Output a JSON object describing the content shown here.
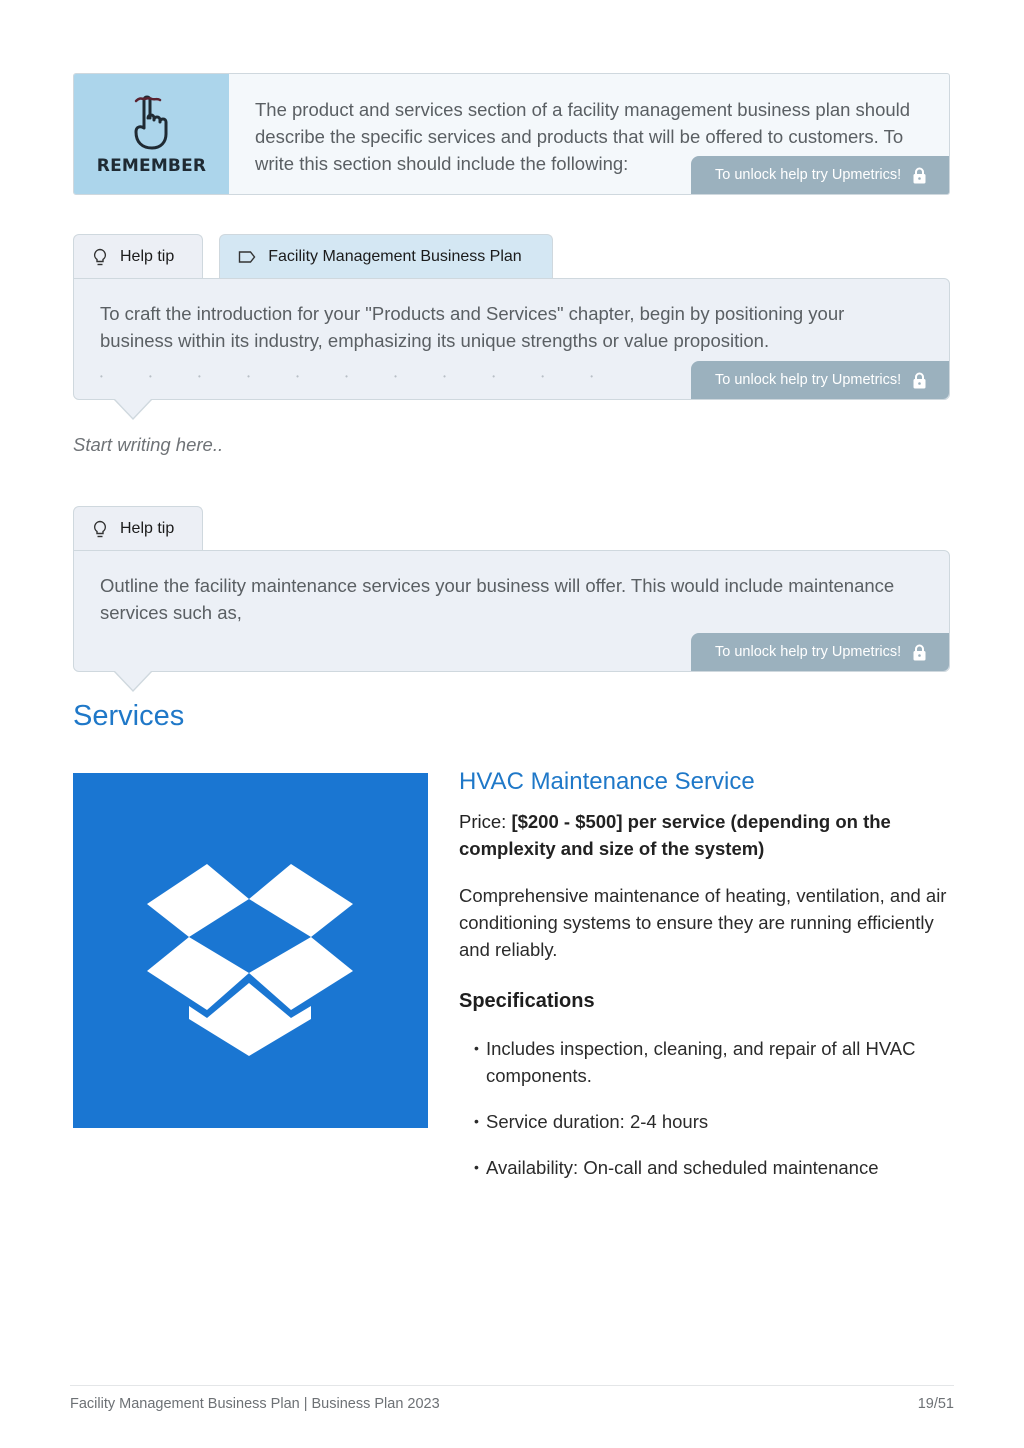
{
  "remember": {
    "label": "REMEMBER",
    "icon": "finger-string-reminder-icon",
    "text": "The product and services section of a facility management business plan should describe the specific services and products that will be offered to customers. To write this section should include the following:",
    "unlock_label": "To unlock help try Upmetrics!"
  },
  "tip1": {
    "tabs": [
      {
        "label": "Help tip",
        "icon": "lightbulb-icon"
      },
      {
        "label": "Facility Management Business Plan",
        "icon": "tag-icon"
      }
    ],
    "text": "To craft the introduction for your \"Products and Services\" chapter, begin by positioning your business within its industry, emphasizing its unique strengths or value proposition.",
    "unlock_label": "To unlock help try Upmetrics!"
  },
  "editor": {
    "placeholder": "Start writing here.."
  },
  "tip2": {
    "tabs": [
      {
        "label": "Help tip",
        "icon": "lightbulb-icon"
      }
    ],
    "text": "Outline the facility maintenance services your business will offer. This would include maintenance services such as,",
    "unlock_label": "To unlock help try Upmetrics!"
  },
  "services": {
    "title": "Services",
    "product": {
      "image_icon": "open-box-icon",
      "name": "HVAC Maintenance Service",
      "price_label": "Price:",
      "price_value": "[$200 - $500] per service (depending on the complexity and size of the system)",
      "description": "Comprehensive maintenance of heating, ventilation, and air conditioning systems to ensure they are running efficiently and reliably.",
      "spec_title": "Specifications",
      "specs": [
        "Includes inspection, cleaning, and repair of all HVAC components.",
        "Service duration: 2-4 hours",
        "Availability: On-call and scheduled maintenance"
      ]
    }
  },
  "footer": {
    "left": "Facility Management Business Plan | Business Plan 2023",
    "page": "19/51"
  },
  "colors": {
    "accent": "#1f78c8",
    "image_bg": "#1a76d2",
    "remember_side": "#acd5eb",
    "unlock_badge": "#9bb1be"
  }
}
